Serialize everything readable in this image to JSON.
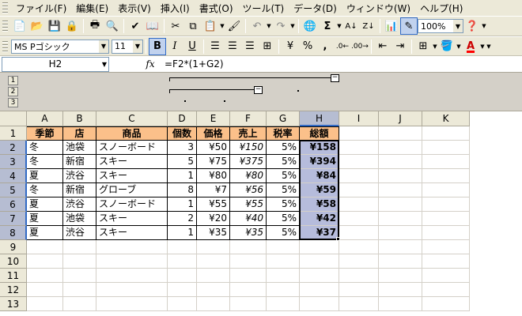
{
  "menu": {
    "items": [
      "ファイル(F)",
      "編集(E)",
      "表示(V)",
      "挿入(I)",
      "書式(O)",
      "ツール(T)",
      "データ(D)",
      "ウィンドウ(W)",
      "ヘルプ(H)"
    ]
  },
  "toolbar": {
    "zoom": "100%"
  },
  "format_bar": {
    "font_name": "MS Pゴシック",
    "font_size": "11",
    "bold_label": "B",
    "italic_label": "I",
    "underline_label": "U",
    "currency": "¥",
    "percent": "%",
    "comma": ",",
    "font_color_label": "A"
  },
  "formula_bar": {
    "name_box": "H2",
    "fx": "fx",
    "formula": "=F2*(1+G2)"
  },
  "outline": {
    "levels": [
      "1",
      "2",
      "3"
    ],
    "minus": "−"
  },
  "sheet": {
    "columns": [
      "A",
      "B",
      "C",
      "D",
      "E",
      "F",
      "G",
      "H",
      "I",
      "J",
      "K"
    ],
    "rows": [
      "1",
      "2",
      "3",
      "4",
      "5",
      "6",
      "7",
      "8",
      "9",
      "10",
      "11",
      "12",
      "13"
    ],
    "header": [
      "季節",
      "店",
      "商品",
      "個数",
      "価格",
      "売上",
      "税率",
      "総額"
    ],
    "data": [
      [
        "冬",
        "池袋",
        "スノーボード",
        "3",
        "¥50",
        "¥150",
        "5%",
        "¥158"
      ],
      [
        "冬",
        "新宿",
        "スキー",
        "5",
        "¥75",
        "¥375",
        "5%",
        "¥394"
      ],
      [
        "夏",
        "渋谷",
        "スキー",
        "1",
        "¥80",
        "¥80",
        "5%",
        "¥84"
      ],
      [
        "冬",
        "新宿",
        "グローブ",
        "8",
        "¥7",
        "¥56",
        "5%",
        "¥59"
      ],
      [
        "夏",
        "渋谷",
        "スノーボード",
        "1",
        "¥55",
        "¥55",
        "5%",
        "¥58"
      ],
      [
        "夏",
        "池袋",
        "スキー",
        "2",
        "¥20",
        "¥40",
        "5%",
        "¥42"
      ],
      [
        "夏",
        "渋谷",
        "スキー",
        "1",
        "¥35",
        "¥35",
        "5%",
        "¥37"
      ]
    ],
    "active_cell": "H2",
    "header_fill": "#fbc08a",
    "selection_fill": "#b6bcdc"
  }
}
